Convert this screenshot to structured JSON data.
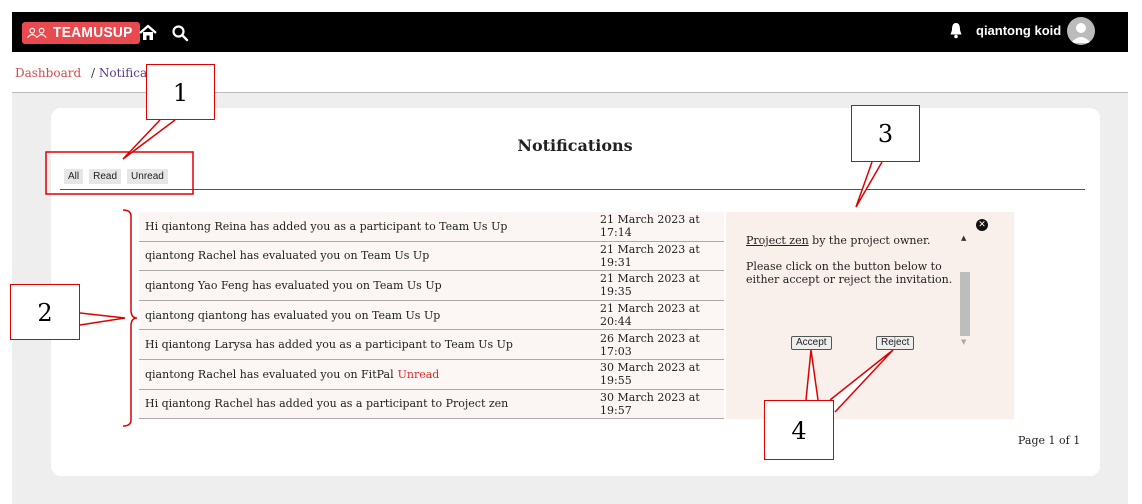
{
  "header": {
    "logo_text": "TEAMUSUP",
    "username": "qiantong koid",
    "colors": {
      "bar": "#000000",
      "brand": "#e84a4f"
    }
  },
  "breadcrumb": {
    "root": "Dashboard",
    "separator": "/",
    "current": "Notification"
  },
  "page": {
    "title": "Notifications"
  },
  "filters": [
    "All",
    "Read",
    "Unread"
  ],
  "notifications": [
    {
      "text": "Hi qiantong Reina has added you as a participant to Team Us Up",
      "unread": "",
      "date": "21 March 2023 at 17:14"
    },
    {
      "text": "qiantong Rachel has evaluated you on Team Us Up",
      "unread": "",
      "date": "21 March 2023 at 19:31"
    },
    {
      "text": "qiantong Yao Feng has evaluated you on Team Us Up",
      "unread": "",
      "date": "21 March 2023 at 19:35"
    },
    {
      "text": "qiantong qiantong has evaluated you on Team Us Up",
      "unread": "",
      "date": "21 March 2023 at 20:44"
    },
    {
      "text": "Hi qiantong Larysa has added you as a participant to Team Us Up",
      "unread": "",
      "date": "26 March 2023 at 17:03"
    },
    {
      "text": "qiantong Rachel has evaluated you on FitPal",
      "unread": "Unread",
      "date": "30 March 2023 at 19:55"
    },
    {
      "text": "Hi qiantong Rachel has added you as a participant to Project zen",
      "unread": "",
      "date": "30 March 2023 at 19:57"
    }
  ],
  "detail": {
    "project_link": "Project zen",
    "line1_suffix": " by the project owner.",
    "instruction": "Please click on the button below to either accept or reject the invitation.",
    "accept_label": "Accept",
    "reject_label": "Reject"
  },
  "pagination": {
    "label": "Page 1 of 1"
  },
  "annotations": [
    "1",
    "2",
    "3",
    "4"
  ],
  "icons": [
    "logo-mark-icon",
    "home-icon",
    "search-icon",
    "bell-icon",
    "avatar-icon",
    "close-icon",
    "scroll-up-icon",
    "scroll-down-icon"
  ]
}
